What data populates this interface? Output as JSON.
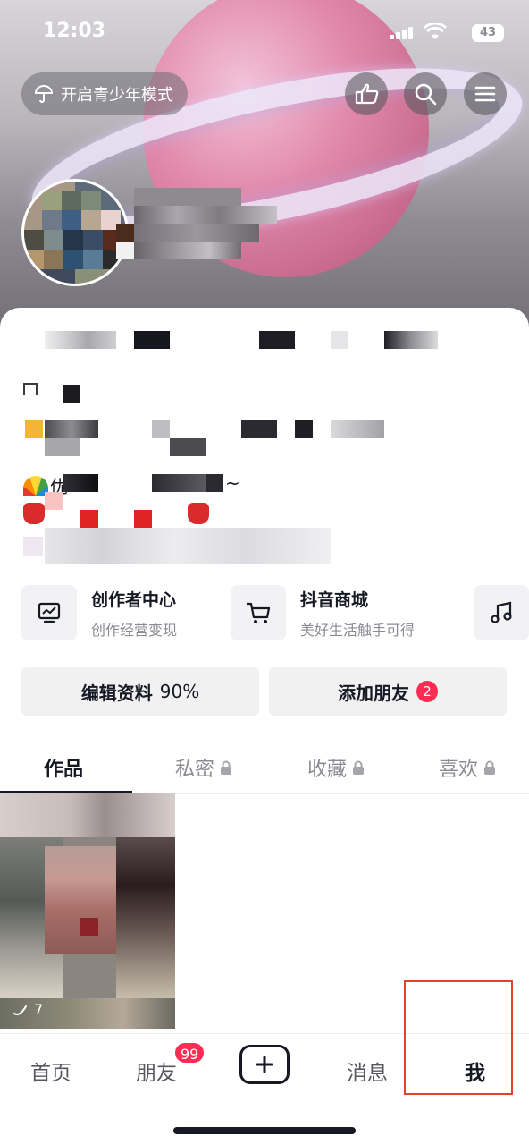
{
  "status_bar": {
    "time": "12:03",
    "battery": "43"
  },
  "header": {
    "teen_mode_label": "开启青少年模式"
  },
  "profile": {
    "bio_fragment": "优",
    "bio_tail": "~"
  },
  "services": [
    {
      "title": "创作者中心",
      "subtitle": "创作经营变现"
    },
    {
      "title": "抖音商城",
      "subtitle": "美好生活触手可得"
    }
  ],
  "actions": {
    "edit_profile": "编辑资料",
    "edit_progress": "90%",
    "add_friends": "添加朋友",
    "add_friends_badge": "2"
  },
  "tabs": [
    {
      "label": "作品"
    },
    {
      "label": "私密"
    },
    {
      "label": "收藏"
    },
    {
      "label": "喜欢"
    }
  ],
  "video": {
    "play_count": "7"
  },
  "nav": {
    "home": "首页",
    "friends": "朋友",
    "friends_badge": "99",
    "messages": "消息",
    "me": "我"
  },
  "colors": {
    "accent_red": "#fe2c55",
    "highlight_box": "#e5412c"
  }
}
